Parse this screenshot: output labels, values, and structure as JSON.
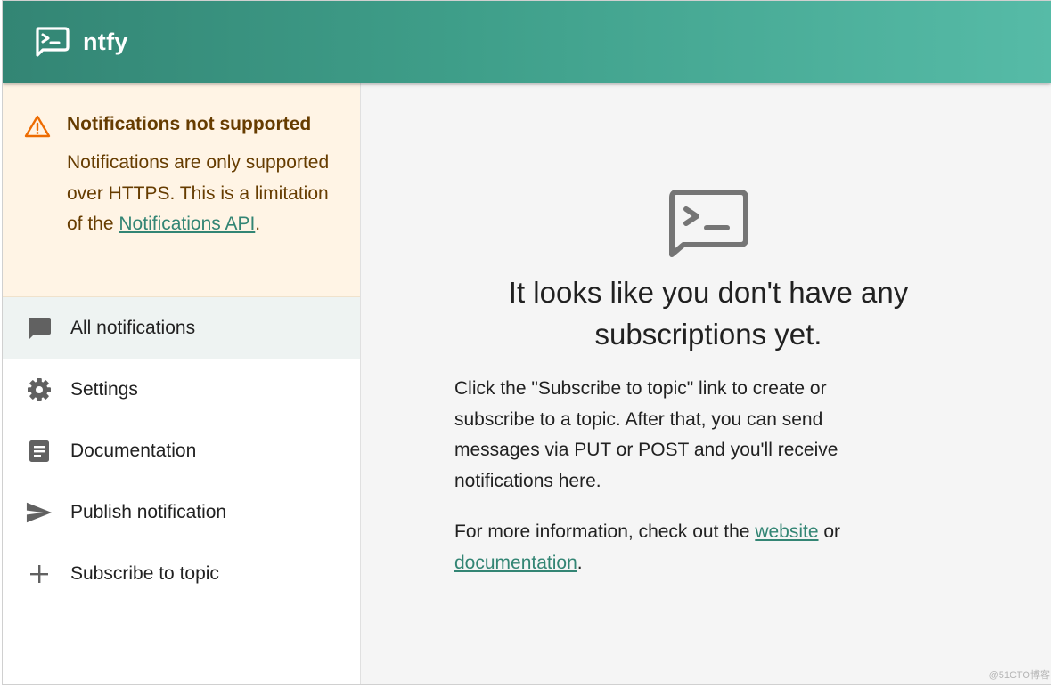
{
  "app": {
    "title": "ntfy",
    "brand_color": "#338574"
  },
  "alert": {
    "title": "Notifications not supported",
    "body_prefix": "Notifications are only supported over HTTPS. This is a limitation of the ",
    "link_text": "Notifications API",
    "body_suffix": ".",
    "icon": "warning-icon",
    "color": "#ed6c02"
  },
  "nav": {
    "items": [
      {
        "label": "All notifications",
        "icon": "chat-icon",
        "selected": true
      },
      {
        "label": "Settings",
        "icon": "gear-icon"
      },
      {
        "label": "Documentation",
        "icon": "document-icon"
      },
      {
        "label": "Publish notification",
        "icon": "send-icon"
      },
      {
        "label": "Subscribe to topic",
        "icon": "plus-icon"
      }
    ]
  },
  "empty": {
    "title": "It looks like you don't have any subscriptions yet.",
    "para1": "Click the \"Subscribe to topic\" link to create or subscribe to a topic. After that, you can send messages via PUT or POST and you'll receive notifications here.",
    "para2_prefix": "For more information, check out the ",
    "link_website": "website",
    "para2_middle": " or ",
    "link_docs": "documentation",
    "para2_suffix": "."
  },
  "watermark": "@51CTO博客"
}
